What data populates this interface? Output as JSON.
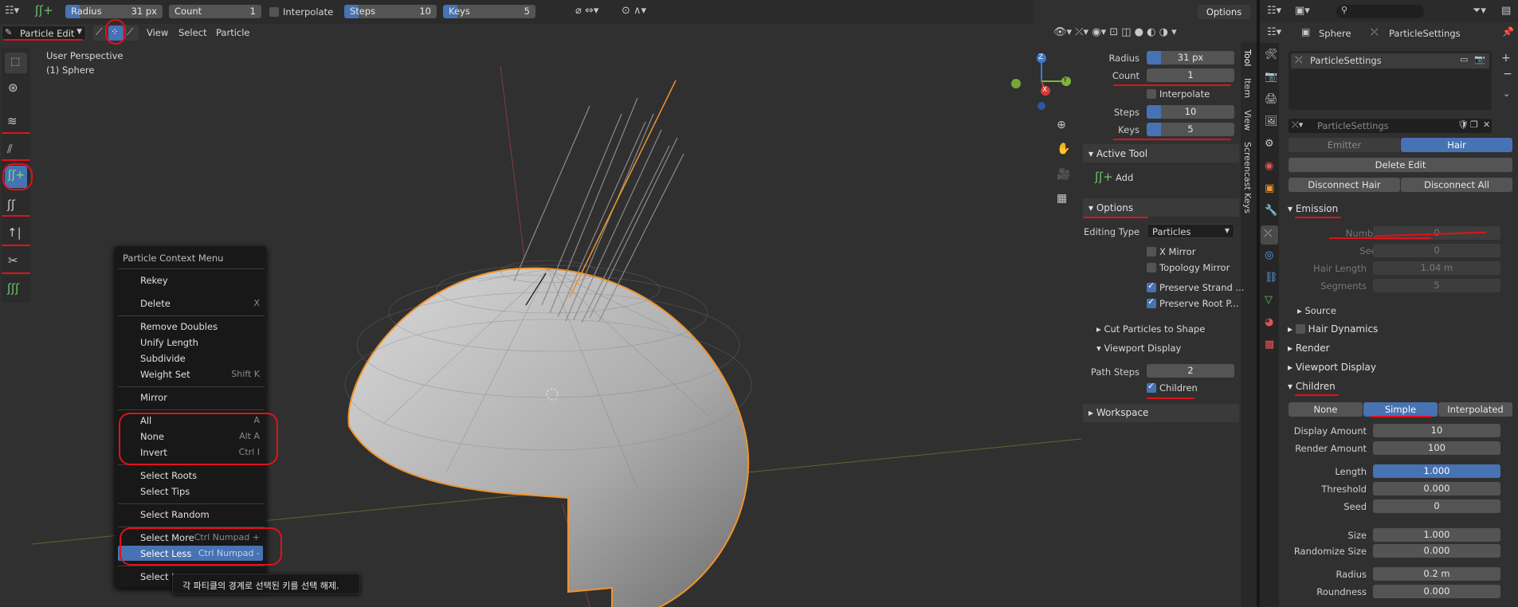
{
  "topbar": {
    "radius_label": "Radius",
    "radius_value": "31 px",
    "count_label": "Count",
    "count_value": "1",
    "interpolate_label": "Interpolate",
    "steps_label": "Steps",
    "steps_value": "10",
    "keys_label": "Keys",
    "keys_value": "5",
    "options_label": "Options"
  },
  "header": {
    "mode": "Particle Edit",
    "menus": [
      "View",
      "Select",
      "Particle"
    ]
  },
  "viewport": {
    "perspective": "User Perspective",
    "object": "(1) Sphere",
    "gizmo": {
      "z": "Z",
      "y": "Y",
      "x": "X"
    }
  },
  "context_menu": {
    "title": "Particle Context Menu",
    "items": [
      {
        "label": "Rekey",
        "shortcut": ""
      },
      {
        "label": "Delete",
        "shortcut": "X"
      },
      {
        "label": "Remove Doubles",
        "shortcut": ""
      },
      {
        "label": "Unify Length",
        "shortcut": ""
      },
      {
        "label": "Subdivide",
        "shortcut": ""
      },
      {
        "label": "Weight Set",
        "shortcut": "Shift K"
      },
      {
        "label": "Mirror",
        "shortcut": ""
      },
      {
        "label": "All",
        "shortcut": "A"
      },
      {
        "label": "None",
        "shortcut": "Alt A"
      },
      {
        "label": "Invert",
        "shortcut": "Ctrl I"
      },
      {
        "label": "Select Roots",
        "shortcut": ""
      },
      {
        "label": "Select Tips",
        "shortcut": ""
      },
      {
        "label": "Select Random",
        "shortcut": ""
      },
      {
        "label": "Select More",
        "shortcut": "Ctrl Numpad +"
      },
      {
        "label": "Select Less",
        "shortcut": "Ctrl Numpad -"
      },
      {
        "label": "Select L",
        "shortcut": ""
      }
    ],
    "tooltip": "각 파티클의 경계로 선택된 키를 선택 해제."
  },
  "npanel": {
    "tabs": [
      "Tool",
      "Item",
      "View",
      "Screencast Keys"
    ],
    "radius_label": "Radius",
    "radius_value": "31 px",
    "count_label": "Count",
    "count_value": "1",
    "interpolate_label": "Interpolate",
    "steps_label": "Steps",
    "steps_value": "10",
    "keys_label": "Keys",
    "keys_value": "5",
    "active_tool_header": "Active Tool",
    "active_tool_name": "Add",
    "options_header": "Options",
    "editing_type_label": "Editing Type",
    "editing_type_value": "Particles",
    "x_mirror": "X Mirror",
    "topology_mirror": "Topology Mirror",
    "preserve_strand": "Preserve Strand ...",
    "preserve_root": "Preserve Root P...",
    "cut_particles": "Cut Particles to Shape",
    "viewport_display": "Viewport Display",
    "path_steps_label": "Path Steps",
    "path_steps_value": "2",
    "children_label": "Children",
    "workspace_header": "Workspace"
  },
  "properties": {
    "search_placeholder": "",
    "breadcrumb_object": "Sphere",
    "breadcrumb_settings": "ParticleSettings",
    "list_item": "ParticleSettings",
    "settings_field": "ParticleSettings",
    "emitter_label": "Emitter",
    "hair_label": "Hair",
    "delete_edit": "Delete Edit",
    "disconnect_hair": "Disconnect Hair",
    "disconnect_all": "Disconnect All",
    "emission_header": "Emission",
    "number_label": "Number",
    "number_value": "0",
    "seed_label": "Seed",
    "seed_value": "0",
    "hair_length_label": "Hair Length",
    "hair_length_value": "1.04 m",
    "segments_label": "Segments",
    "segments_value": "5",
    "source_label": "Source",
    "hair_dynamics_header": "Hair Dynamics",
    "render_header": "Render",
    "viewport_display_header": "Viewport Display",
    "children_header": "Children",
    "child_modes": [
      "None",
      "Simple",
      "Interpolated"
    ],
    "display_amount_label": "Display Amount",
    "display_amount_value": "10",
    "render_amount_label": "Render Amount",
    "render_amount_value": "100",
    "length_label": "Length",
    "length_value": "1.000",
    "threshold_label": "Threshold",
    "threshold_value": "0.000",
    "seed2_label": "Seed",
    "seed2_value": "0",
    "size_label": "Size",
    "size_value": "1.000",
    "randomize_size_label": "Randomize Size",
    "randomize_size_value": "0.000",
    "radius_label": "Radius",
    "radius_value": "0.2 m",
    "roundness_label": "Roundness",
    "roundness_value": "0.000"
  },
  "colors": {
    "accent": "#4772b3",
    "annotation": "#e0121a",
    "selection": "#f0932b"
  }
}
